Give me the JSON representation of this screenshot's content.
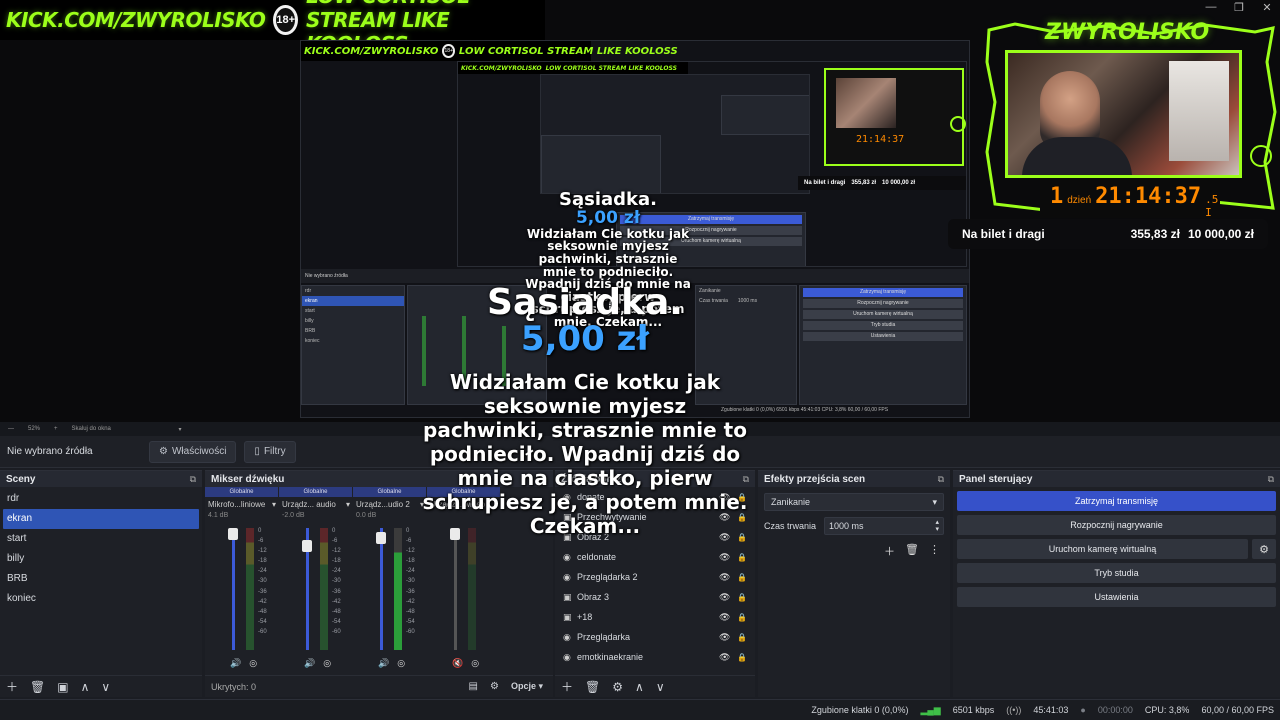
{
  "window_controls": [
    "—",
    "❐",
    "✕"
  ],
  "overlay": {
    "banner_left": "KICK.COM/ZWYROLISKO",
    "banner_badge": "18+",
    "banner_right": "LOW CORTISOL STREAM LIKE KOOLOSS",
    "cam_title": "ZWYROLISKO",
    "timer_day_num": "1",
    "timer_day_label": "dzień",
    "timer_time": "21:14:37",
    "timer_sub": ".5 I",
    "goal_name": "Na bilet i dragi",
    "goal_current": "355,83 zł",
    "goal_target": "10 000,00 zł"
  },
  "alert": {
    "name": "Sąsiadka.",
    "amount": "5,00 zł",
    "message": "Widziałam Cie kotku jak seksownie myjesz pachwinki, strasznie mnie to podnieciło. Wpadnij dziś do mnie na ciastko, pierw schrupiesz je, a potem mnie. Czekam..."
  },
  "nested": {
    "no_source": "Nie wybrano źródła",
    "scenes": [
      "rdr",
      "ekran",
      "start",
      "billy",
      "BRB",
      "koniec"
    ],
    "transition": "Zanikanie",
    "duration_label": "Czas trwania",
    "duration": "1000 ms",
    "controls": [
      "Zatrzymaj transmisję",
      "Rozpocznij nagrywanie",
      "Uruchom kamerę wirtualną",
      "Tryb studia",
      "Ustawienia"
    ],
    "status": "Zgubione klatki 0 (0,0%)   6501 kbps   45:41:03   CPU: 3,8%   60,00 / 60,00 FPS",
    "zoom": "52%",
    "zoom_label": "Skaluj do okna"
  },
  "zoombar": {
    "minus": "—",
    "percent": "52%",
    "plus": "+",
    "scale": "Skaluj do okna",
    "arrow": "▾"
  },
  "source_toolbar": {
    "no_source": "Nie wybrano źródła",
    "properties": "Właściwości",
    "filters": "Filtry"
  },
  "scenes_dock": {
    "title": "Sceny",
    "items": [
      "rdr",
      "ekran",
      "start",
      "billy",
      "BRB",
      "koniec"
    ],
    "selected": "ekran"
  },
  "mixer_dock": {
    "title": "Mikser dźwięku",
    "group_label": "Globalne",
    "channels": [
      {
        "name": "Mikrofo...liniowe",
        "db": "4.1 dB"
      },
      {
        "name": "Urządz... audio",
        "db": "-2.0 dB"
      },
      {
        "name": "Urządz...udio 2",
        "db": "0.0 dB"
      },
      {
        "name": "Urządz... wideo",
        "db": ""
      }
    ],
    "ticks": [
      "0",
      "-6",
      "-12",
      "-18",
      "-24",
      "-30",
      "-36",
      "-42",
      "-48",
      "-54",
      "-60"
    ],
    "hidden": "Ukrytych: 0",
    "options": "Opcje"
  },
  "sources_dock": {
    "title": "Źródła obrazu",
    "items": [
      {
        "icon": "◉",
        "label": "donate"
      },
      {
        "icon": "▣",
        "label": "Przechwytywanie"
      },
      {
        "icon": "▣",
        "label": "Obraz 2"
      },
      {
        "icon": "◉",
        "label": "celdonate"
      },
      {
        "icon": "◉",
        "label": "Przeglądarka 2"
      },
      {
        "icon": "▣",
        "label": "Obraz 3"
      },
      {
        "icon": "▣",
        "label": "+18"
      },
      {
        "icon": "◉",
        "label": "Przeglądarka"
      },
      {
        "icon": "◉",
        "label": "emotkinaekranie"
      }
    ]
  },
  "transitions_dock": {
    "title": "Efekty przejścia scen",
    "selected": "Zanikanie",
    "duration_label": "Czas trwania",
    "duration": "1000 ms"
  },
  "controls_dock": {
    "title": "Panel sterujący",
    "stop_stream": "Zatrzymaj transmisję",
    "start_record": "Rozpocznij nagrywanie",
    "virtual_cam": "Uruchom kamerę wirtualną",
    "studio_mode": "Tryb studia",
    "settings": "Ustawienia"
  },
  "status_bar": {
    "dropped": "Zgubione klatki 0 (0,0%)",
    "bitrate": "6501 kbps",
    "stream_time": "45:41:03",
    "record_time": "00:00:00",
    "cpu": "CPU: 3,8%",
    "fps": "60,00 / 60,00 FPS"
  },
  "colors": {
    "accent": "#3651c9",
    "selection": "#2f55b5",
    "neon": "#9cff1a",
    "donation_blue": "#3ba1ff",
    "timer": "#ff8a00"
  }
}
